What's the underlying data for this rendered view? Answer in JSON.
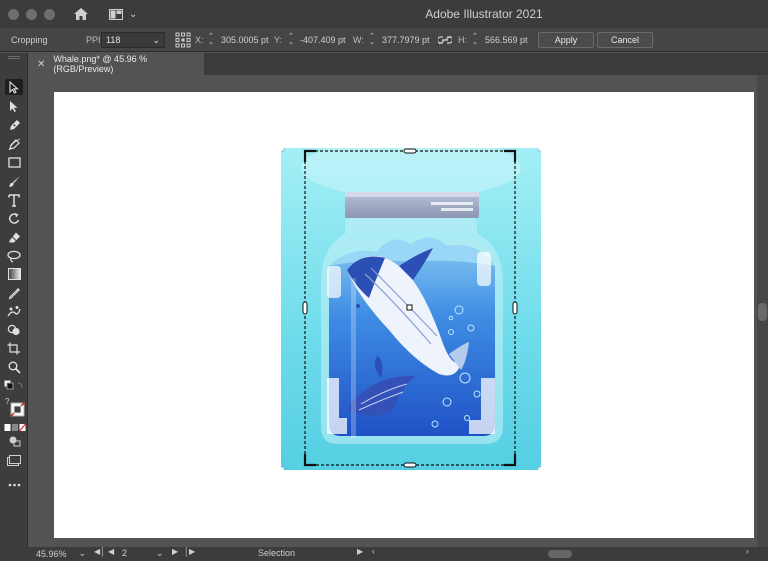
{
  "app": {
    "title": "Adobe Illustrator 2021"
  },
  "control_bar": {
    "mode_label": "Cropping",
    "ppi_label": "PPI:",
    "ppi_value": "118",
    "x_label": "X:",
    "x_value": "305.0005 pt",
    "y_label": "Y:",
    "y_value": "-407.409 pt",
    "w_label": "W:",
    "w_value": "377.7979 pt",
    "h_label": "H:",
    "h_value": "566.569 pt",
    "apply_label": "Apply",
    "cancel_label": "Cancel"
  },
  "document_tab": {
    "label": "Whale.png* @ 45.96 % (RGB/Preview)"
  },
  "status_bar": {
    "zoom": "45.96%",
    "artboard_number": "2",
    "tool_name": "Selection"
  },
  "colors": {
    "ui_dark": "#3c3c3c",
    "ui_mid": "#535353",
    "artboard": "#ffffff",
    "image_cyan": "#8ee6f0",
    "jar_blue": "#2f6fd6",
    "whale_dark": "#2436a0"
  },
  "tools": [
    {
      "name": "selection-tool-icon",
      "active": true
    },
    {
      "name": "direct-selection-tool-icon"
    },
    {
      "name": "pen-tool-icon"
    },
    {
      "name": "curvature-tool-icon"
    },
    {
      "name": "rectangle-tool-icon"
    },
    {
      "name": "paintbrush-tool-icon"
    },
    {
      "name": "type-tool-icon"
    },
    {
      "name": "rotate-tool-icon"
    },
    {
      "name": "eraser-tool-icon"
    },
    {
      "name": "lasso-tool-icon"
    },
    {
      "name": "gradient-tool-icon"
    },
    {
      "name": "eyedropper-tool-icon"
    },
    {
      "name": "puppet-warp-tool-icon"
    },
    {
      "name": "shape-builder-tool-icon"
    },
    {
      "name": "artboard-tool-icon"
    },
    {
      "name": "zoom-tool-icon"
    }
  ]
}
